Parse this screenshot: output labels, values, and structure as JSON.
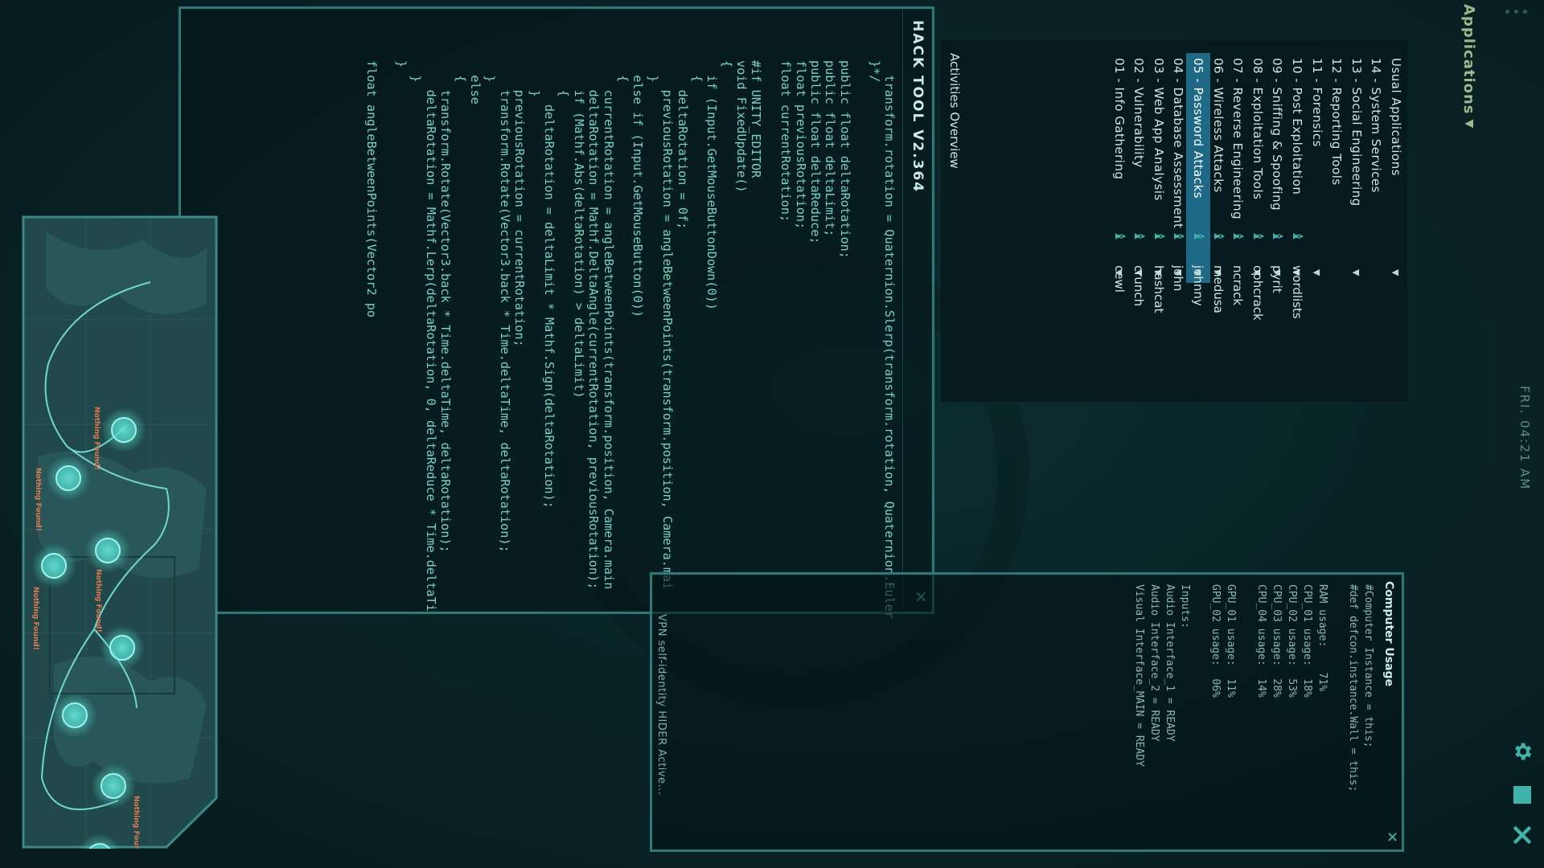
{
  "topbar": {
    "applications_label": "Applications",
    "clock": "FRI. 04:21 AM",
    "icons": [
      "gear-icon",
      "square-icon",
      "close-icon"
    ]
  },
  "menu": {
    "categories": [
      {
        "label": "01 - Info Gathering",
        "active": false,
        "arrow": true
      },
      {
        "label": "02 - Vulnerability",
        "active": false,
        "arrow": true
      },
      {
        "label": "03 - Web App Analysis",
        "active": false,
        "arrow": true
      },
      {
        "label": "04 - Database Assessment",
        "active": false,
        "arrow": true
      },
      {
        "label": "05 - Password Attacks",
        "active": true,
        "arrow": true
      },
      {
        "label": "06 - Wireless Attacks",
        "active": false,
        "arrow": true
      },
      {
        "label": "07 - Reverse Engineering",
        "active": false,
        "arrow": false
      },
      {
        "label": "08 - Exploitation Tools",
        "active": false,
        "arrow": true
      },
      {
        "label": "09 - Sniffing & Spoofing",
        "active": false,
        "arrow": true
      },
      {
        "label": "10 - Post Exploitation",
        "active": false,
        "arrow": true
      },
      {
        "label": "11 - Forensics",
        "active": false,
        "arrow": true
      },
      {
        "label": "12 - Reporting Tools",
        "active": false,
        "arrow": false
      },
      {
        "label": "13 - Social Engineering",
        "active": false,
        "arrow": true
      },
      {
        "label": "14 - System Services",
        "active": false,
        "arrow": false
      },
      {
        "label": "Usual Applications",
        "active": false,
        "arrow": true
      }
    ],
    "tools": [
      "cewl",
      "crunch",
      "hashcat",
      "john",
      "johnny",
      "medusa",
      "ncrack",
      "ophcrack",
      "pyrit",
      "wordlists"
    ],
    "activities": "Activities Overview"
  },
  "hack_tool": {
    "title": "HACK TOOL V2.364",
    "code_lines": [
      "  transform.rotation = Quaternion.Slerp(transform.rotation, Quaternion.Euler",
      "}*/",
      "",
      "public float deltaRotation;",
      "public float deltaLimit;",
      "public float deltaReduce;",
      "float previousRotation;",
      "float currentRotation;",
      "",
      "#if UNITY_EDITOR",
      "void FixedUpdate()",
      "{",
      "  if (Input.GetMouseButtonDown(0))",
      "  {",
      "    deltaRotation = 0f;",
      "    previousRotation = angleBetweenPoints(transform.position, Camera.mai",
      "  }",
      "  else if (Input.GetMouseButton(0))",
      "  {",
      "    currentRotation = angleBetweenPoints(transform.position, Camera.main",
      "    deltaRotation = Mathf.DeltaAngle(currentRotation, previousRotation);",
      "    if (Mathf.Abs(deltaRotation) > deltaLimit)",
      "    {",
      "      deltaRotation = deltaLimit * Mathf.Sign(deltaRotation);",
      "    }",
      "    previousRotation = currentRotation;",
      "    transform.Rotate(Vector3.back * Time.deltaTime, deltaRotation);",
      "  }",
      "  else",
      "  {",
      "    transform.Rotate(Vector3.back * Time.deltaTime, deltaRotation);",
      "    deltaRotation = Mathf.Lerp(deltaRotation, 0, deltaReduce * Time.deltaTi",
      "  }",
      "}",
      "",
      "float angleBetweenPoints(Vector2 po"
    ]
  },
  "usage": {
    "title": "Computer Usage",
    "lines": [
      "#Computer Instance = this;",
      "#def defcon.instance.Wall = this;",
      "",
      "RAM usage:    71%",
      "CPU_01 usage:  18%",
      "CPU_02 usage:  53%",
      "CPU_03 usage:  28%",
      "CPU_04 usage:  14%",
      "",
      "GPU_01 usage:  11%",
      "GPU_02 usage:  06%",
      "",
      "Inputs:",
      "Audio Interface_1 = READY",
      "Audio Interface_2 = READY",
      "Visual Interface_MAIN = READY"
    ],
    "vpn": "VPN self-identity HIDER Active..."
  },
  "map": {
    "node_label": "Nothing Found!",
    "label_color": "#e07a4e",
    "node_color": "#4fd3c6"
  }
}
